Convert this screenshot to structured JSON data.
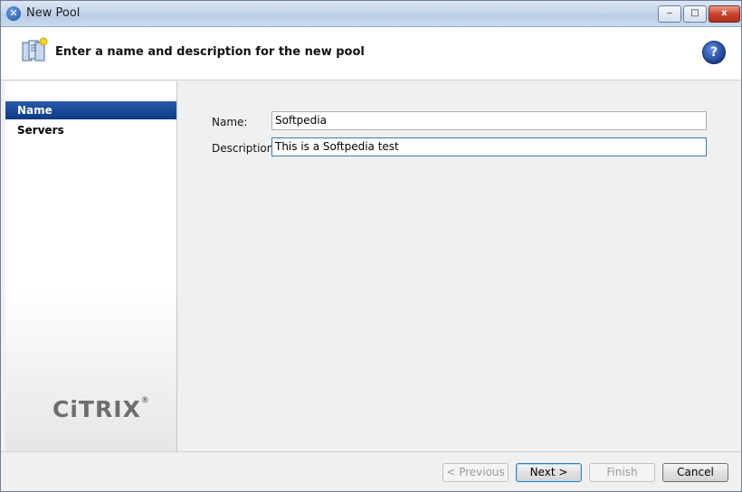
{
  "window": {
    "title": "New Pool"
  },
  "header": {
    "title": "Enter a name and description for the new pool"
  },
  "sidebar": {
    "items": [
      {
        "label": "Name",
        "active": true
      },
      {
        "label": "Servers",
        "active": false
      }
    ],
    "logo_text": "CiTRIX",
    "logo_mark": "®"
  },
  "form": {
    "name_label": "Name:",
    "name_value": "Softpedia",
    "description_label": "Description:",
    "description_value": "This is a Softpedia test"
  },
  "footer": {
    "previous_label": "< Previous",
    "next_label": "Next >",
    "finish_label": "Finish",
    "cancel_label": "Cancel"
  },
  "icons": {
    "app": "xenserver-icon",
    "header": "server-pool-icon",
    "help": "help-icon",
    "help_glyph": "?",
    "min_glyph": "‒",
    "max_glyph": "□",
    "close_glyph": "x"
  },
  "colors": {
    "selection": "#0d3a86",
    "close_button": "#c9432e"
  }
}
